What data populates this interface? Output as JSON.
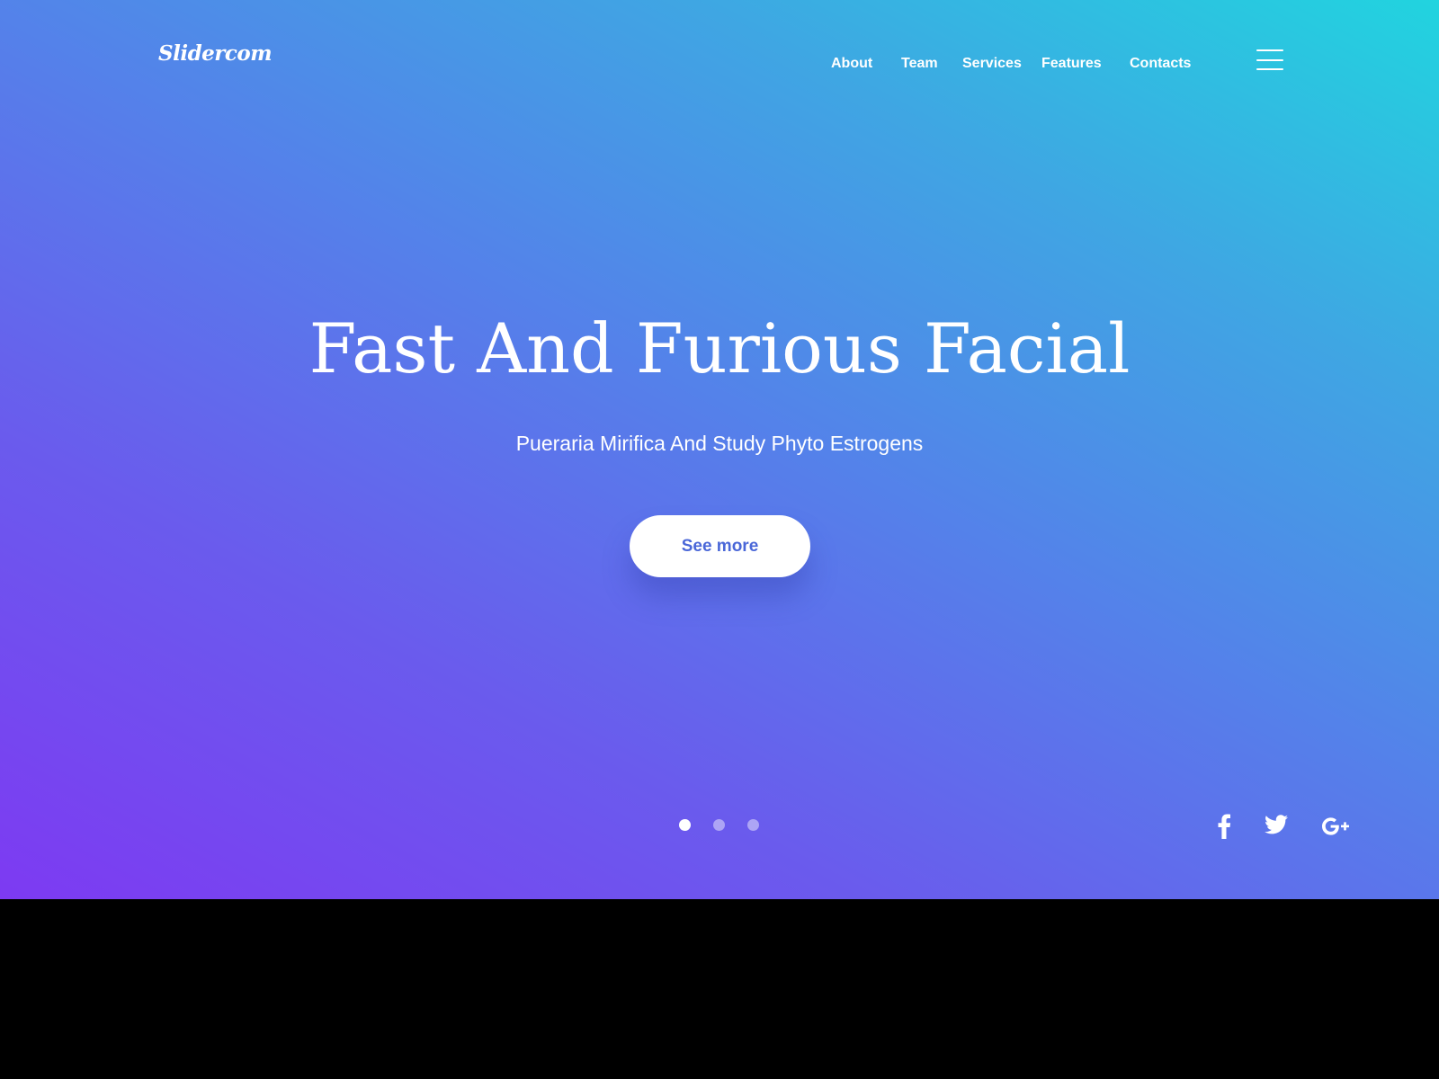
{
  "brand": {
    "logo_text": "Slidercom"
  },
  "nav": {
    "items": [
      {
        "label": "About"
      },
      {
        "label": "Team"
      },
      {
        "label": "Services"
      },
      {
        "label": "Features"
      },
      {
        "label": "Contacts"
      }
    ],
    "menu_icon": "hamburger-menu-icon"
  },
  "hero": {
    "title": "Fast And Furious Facial",
    "subtitle": "Pueraria Mirifica And Study Phyto Estrogens",
    "cta_label": "See more"
  },
  "slider": {
    "slide_count": 3,
    "active_index": 0
  },
  "social": {
    "icons": [
      "facebook-icon",
      "twitter-icon",
      "google-plus-icon"
    ]
  },
  "colors": {
    "gradient_start": "#7d3af2",
    "gradient_mid": "#5580ea",
    "gradient_end": "#21d4df",
    "cta_text": "#4a67d8",
    "dot_active": "#ffffff",
    "dot_inactive": "rgba(255,255,255,0.45)"
  }
}
